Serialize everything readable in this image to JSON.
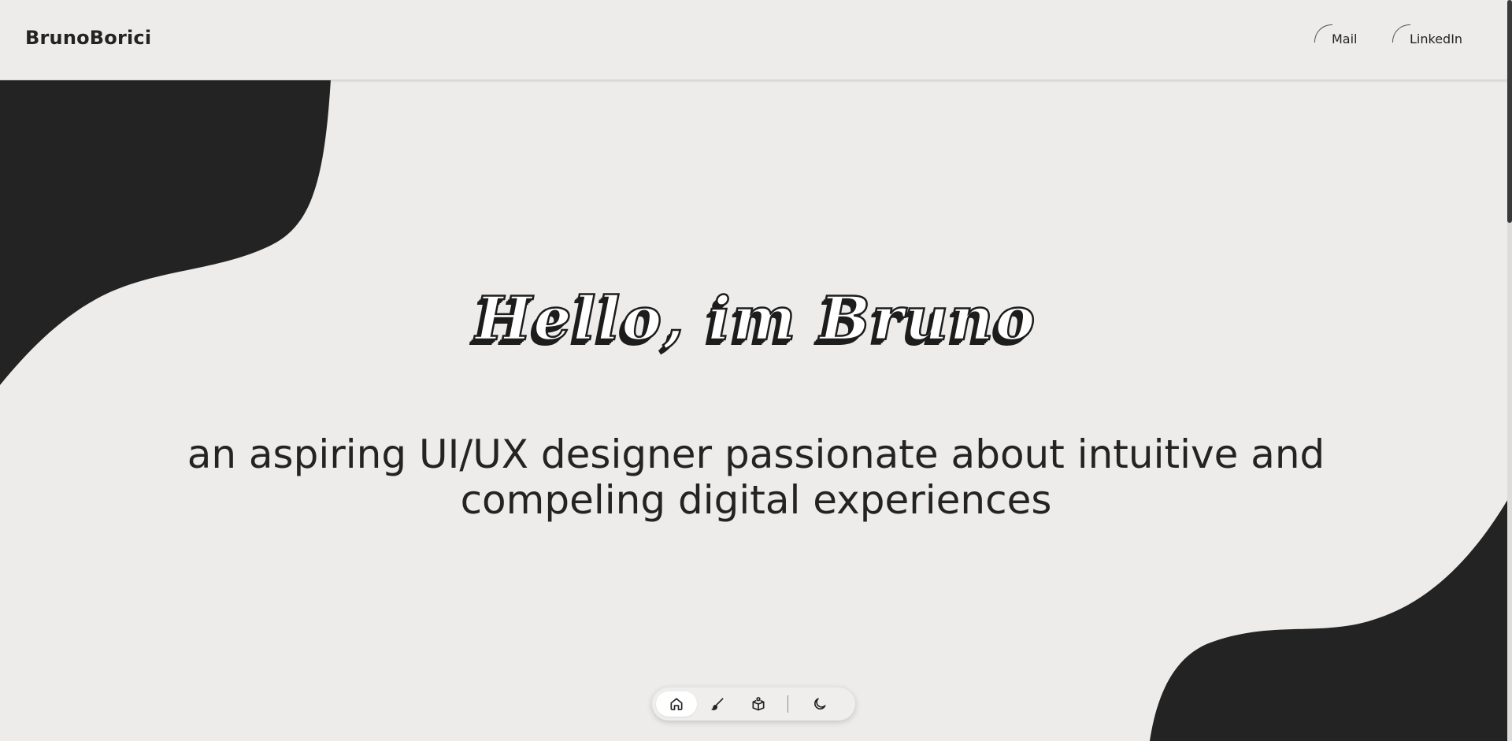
{
  "header": {
    "brand": "BrunoBorici",
    "links": [
      {
        "label": "Mail"
      },
      {
        "label": "LinkedIn"
      }
    ]
  },
  "hero": {
    "title": "Hello, im Bruno",
    "subtitle_line1": "an aspiring UI/UX designer passionate about intuitive and",
    "subtitle_line2": "compeling digital experiences"
  },
  "dock": {
    "items": [
      {
        "icon": "home-icon",
        "active": true
      },
      {
        "icon": "brush-icon",
        "active": false
      },
      {
        "icon": "portfolio-icon",
        "active": false
      },
      {
        "icon": "moon-icon",
        "active": false
      }
    ]
  },
  "colors": {
    "background": "#edecea",
    "ink": "#232323",
    "blob": "#232323",
    "dock_active": "#ffffff"
  }
}
